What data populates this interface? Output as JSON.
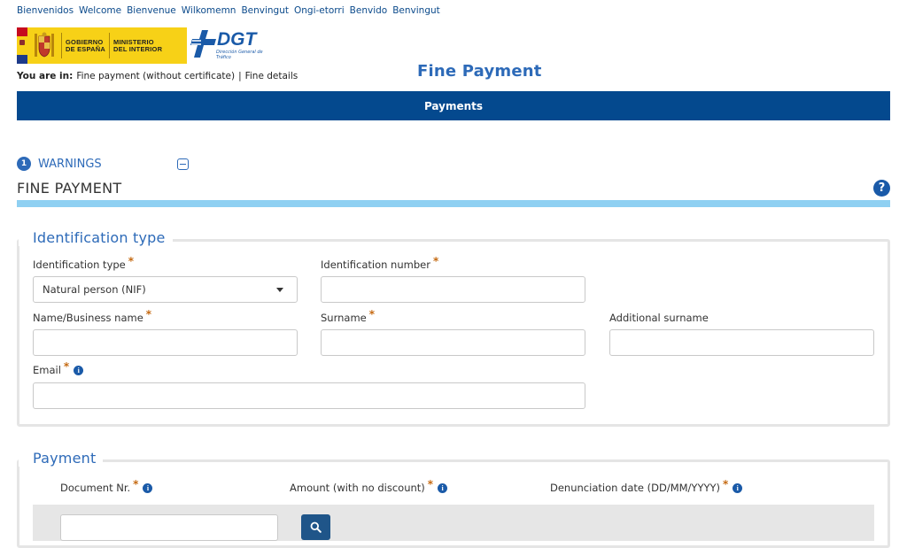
{
  "languages": [
    "Bienvenidos",
    "Welcome",
    "Bienvenue",
    "Wilkomemn",
    "Benvingut",
    "Ongi-etorri",
    "Benvido",
    "Benvingut"
  ],
  "header": {
    "gov_line1": "GOBIERNO",
    "gov_line2": "DE ESPAÑA",
    "ministry_line1": "MINISTERIO",
    "ministry_line2": "DEL INTERIOR",
    "dgt": "DGT",
    "dgt_sub": "Dirección General de Tráfico",
    "title": "Fine Payment"
  },
  "breadcrumb": {
    "prefix": "You are in:",
    "item1": "Fine payment (without certificate)",
    "separator": "|",
    "item2": "Fine details"
  },
  "nav": {
    "label": "Payments"
  },
  "warnings": {
    "count": "1",
    "label": "WARNINGS"
  },
  "section_title": "FINE PAYMENT",
  "help_glyph": "?",
  "identification": {
    "legend": "Identification type",
    "type_label": "Identification type",
    "type_value": "Natural person (NIF)",
    "number_label": "Identification number",
    "name_label": "Name/Business name",
    "surname_label": "Surname",
    "additional_surname_label": "Additional surname",
    "email_label": "Email",
    "required_mark": "*"
  },
  "payment": {
    "legend": "Payment",
    "document_label": "Document Nr.",
    "amount_label": "Amount (with no discount)",
    "date_label": "Denunciation date (DD/MM/YYYY)",
    "required_mark": "*"
  },
  "info_glyph": "i",
  "colors": {
    "nav_bg": "#04498e",
    "accent": "#2d6ab8",
    "section_rule": "#8fd0f2",
    "required": "#c56a12"
  }
}
